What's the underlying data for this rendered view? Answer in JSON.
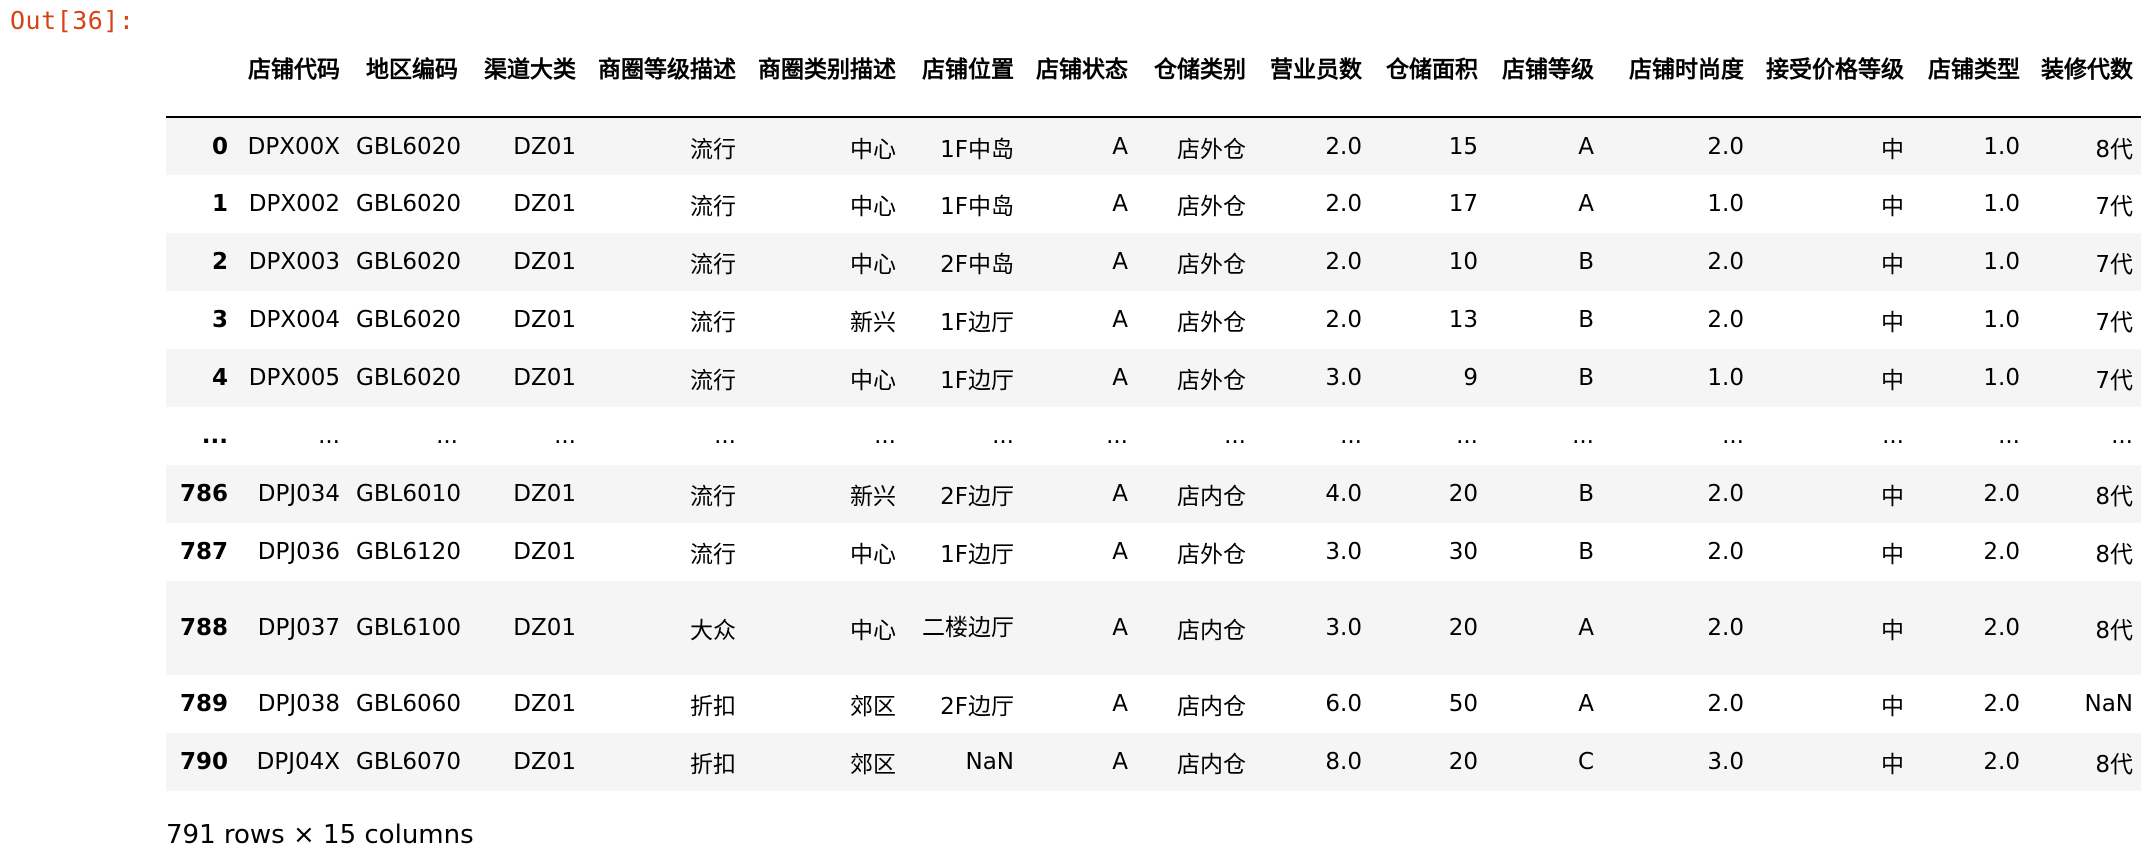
{
  "prompt": "Out[36]:",
  "table": {
    "columns": [
      "店铺代码",
      "地区编码",
      "渠道大类",
      "商圈等级描述",
      "商圈类别描述",
      "店铺位置",
      "店铺状态",
      "仓储类别",
      "营业员数",
      "仓储面积",
      "店铺等级",
      "店铺时尚度",
      "接受价格等级",
      "店铺类型",
      "装修代数"
    ],
    "rows": [
      {
        "index": "0",
        "cells": [
          "DPX00X",
          "GBL6020",
          "DZ01",
          "流行",
          "中心",
          "1F中岛",
          "A",
          "店外仓",
          "2.0",
          "15",
          "A",
          "2.0",
          "中",
          "1.0",
          "8代"
        ]
      },
      {
        "index": "1",
        "cells": [
          "DPX002",
          "GBL6020",
          "DZ01",
          "流行",
          "中心",
          "1F中岛",
          "A",
          "店外仓",
          "2.0",
          "17",
          "A",
          "1.0",
          "中",
          "1.0",
          "7代"
        ]
      },
      {
        "index": "2",
        "cells": [
          "DPX003",
          "GBL6020",
          "DZ01",
          "流行",
          "中心",
          "2F中岛",
          "A",
          "店外仓",
          "2.0",
          "10",
          "B",
          "2.0",
          "中",
          "1.0",
          "7代"
        ]
      },
      {
        "index": "3",
        "cells": [
          "DPX004",
          "GBL6020",
          "DZ01",
          "流行",
          "新兴",
          "1F边厅",
          "A",
          "店外仓",
          "2.0",
          "13",
          "B",
          "2.0",
          "中",
          "1.0",
          "7代"
        ]
      },
      {
        "index": "4",
        "cells": [
          "DPX005",
          "GBL6020",
          "DZ01",
          "流行",
          "中心",
          "1F边厅",
          "A",
          "店外仓",
          "3.0",
          "9",
          "B",
          "1.0",
          "中",
          "1.0",
          "7代"
        ]
      },
      {
        "index": "...",
        "cells": [
          "...",
          "...",
          "...",
          "...",
          "...",
          "...",
          "...",
          "...",
          "...",
          "...",
          "...",
          "...",
          "...",
          "...",
          "..."
        ]
      },
      {
        "index": "786",
        "cells": [
          "DPJ034",
          "GBL6010",
          "DZ01",
          "流行",
          "新兴",
          "2F边厅",
          "A",
          "店内仓",
          "4.0",
          "20",
          "B",
          "2.0",
          "中",
          "2.0",
          "8代"
        ]
      },
      {
        "index": "787",
        "cells": [
          "DPJ036",
          "GBL6120",
          "DZ01",
          "流行",
          "中心",
          "1F边厅",
          "A",
          "店外仓",
          "3.0",
          "30",
          "B",
          "2.0",
          "中",
          "2.0",
          "8代"
        ]
      },
      {
        "index": "788",
        "cells": [
          "DPJ037",
          "GBL6100",
          "DZ01",
          "大众",
          "中心",
          "二楼边厅",
          "A",
          "店内仓",
          "3.0",
          "20",
          "A",
          "2.0",
          "中",
          "2.0",
          "8代"
        ]
      },
      {
        "index": "789",
        "cells": [
          "DPJ038",
          "GBL6060",
          "DZ01",
          "折扣",
          "郊区",
          "2F边厅",
          "A",
          "店内仓",
          "6.0",
          "50",
          "A",
          "2.0",
          "中",
          "2.0",
          "NaN"
        ]
      },
      {
        "index": "790",
        "cells": [
          "DPJ04X",
          "GBL6070",
          "DZ01",
          "折扣",
          "郊区",
          "NaN",
          "A",
          "店内仓",
          "8.0",
          "20",
          "C",
          "3.0",
          "中",
          "2.0",
          "8代"
        ]
      }
    ]
  },
  "shape_note": "791 rows × 15 columns"
}
